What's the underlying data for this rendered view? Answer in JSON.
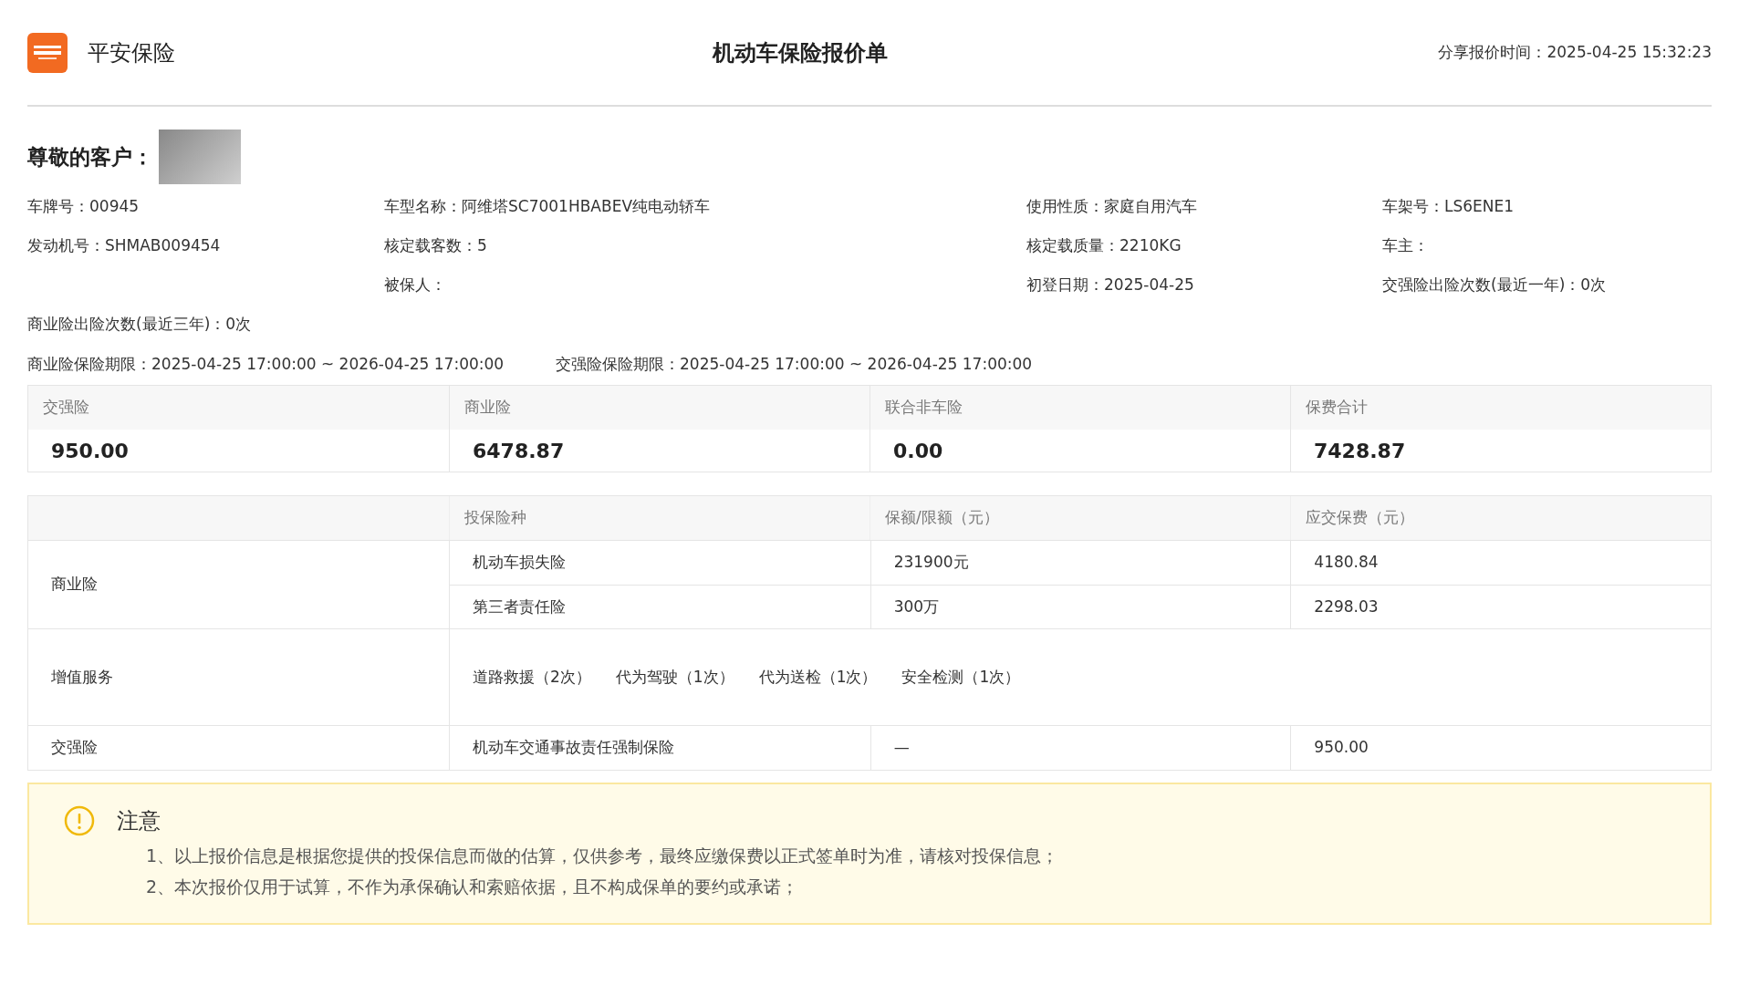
{
  "header": {
    "brand": "平安保险",
    "title": "机动车保险报价单",
    "share_time": "分享报价时间：2025-04-25 15:32:23"
  },
  "greeting": "尊敬的客户：",
  "info_rows": [
    {
      "cells": [
        "车牌号：00945",
        "车型名称：阿维塔SC7001HBABEV纯电动轿车",
        "使用性质：家庭自用汽车",
        "车架号：LS6ENE1"
      ]
    },
    {
      "cells": [
        "发动机号：SHMAB009454",
        "核定载客数：5",
        "核定载质量：2210KG",
        "车主："
      ]
    },
    {
      "cells": [
        "",
        "被保人：",
        "初登日期：2025-04-25",
        "交强险出险次数(最近一年)：0次"
      ]
    },
    {
      "cells": [
        "商业险出险次数(最近三年)：0次",
        "",
        "",
        ""
      ]
    }
  ],
  "periods": [
    "商业险保险期限：2025-04-25 17:00:00 ~ 2026-04-25 17:00:00",
    "交强险保险期限：2025-04-25 17:00:00 ~ 2026-04-25 17:00:00"
  ],
  "summary": [
    {
      "label": "交强险",
      "value": "950.00"
    },
    {
      "label": "商业险",
      "value": "6478.87"
    },
    {
      "label": "联合非车险",
      "value": "0.00"
    },
    {
      "label": "保费合计",
      "value": "7428.87"
    }
  ],
  "detail_table": {
    "columns": [
      "投保险种",
      "保额/限额（元）",
      "应交保费（元）"
    ],
    "groups": [
      {
        "kind": "rows",
        "name": "商业险",
        "rows": [
          [
            "机动车损失险",
            "231900元",
            "4180.84"
          ],
          [
            "第三者责任险",
            "300万",
            "2298.03"
          ]
        ]
      },
      {
        "kind": "services",
        "name": "增值服务",
        "services": [
          "道路救援（2次）",
          "代为驾驶（1次）",
          "代为送检（1次）",
          "安全检测（1次）"
        ]
      },
      {
        "kind": "rows",
        "name": "交强险",
        "rows": [
          [
            "机动车交通事故责任强制保险",
            "—",
            "950.00"
          ]
        ]
      }
    ]
  },
  "notice": {
    "title": "注意",
    "lines": [
      "1、以上报价信息是根据您提供的投保信息而做的估算，仅供参考，最终应缴保费以正式签单时为准，请核对投保信息；",
      "2、本次报价仅用于试算，不作为承保确认和索赔依据，且不构成保单的要约或承诺；"
    ]
  }
}
